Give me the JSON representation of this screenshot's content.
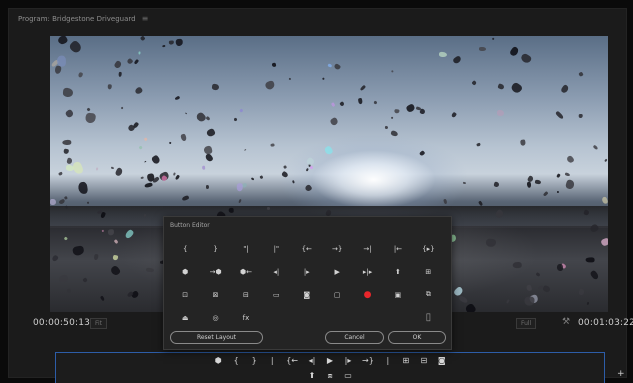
{
  "window": {
    "title": "Program: Bridgestone Driveguard",
    "menu_icon": "menu-lines-icon"
  },
  "timecodes": {
    "current": "00:00:50:13",
    "duration": "00:01:03:22"
  },
  "monitor": {
    "zoom": "Fit",
    "resolution": "Full"
  },
  "transport": {
    "row1": [
      "⬢",
      "{",
      "}",
      "|",
      "{←",
      "◂|",
      "▶",
      "|▸",
      "→}",
      "|",
      "⊞",
      "⊟",
      "◙"
    ],
    "row2": [
      "⬆",
      "⧈",
      "▭"
    ]
  },
  "dialog": {
    "title": "Button Editor",
    "buttons": [
      {
        "glyph": "{",
        "name": "mark-in-icon"
      },
      {
        "glyph": "}",
        "name": "mark-out-icon"
      },
      {
        "glyph": "\"|",
        "name": "clear-in-icon"
      },
      {
        "glyph": "|\"",
        "name": "clear-out-icon"
      },
      {
        "glyph": "{←",
        "name": "go-to-in-icon"
      },
      {
        "glyph": "→}",
        "name": "go-to-out-icon"
      },
      {
        "glyph": "→|",
        "name": "next-edit-icon"
      },
      {
        "glyph": "|←",
        "name": "previous-edit-icon"
      },
      {
        "glyph": "{▸}",
        "name": "play-in-to-out-icon"
      },
      {
        "glyph": "⬢",
        "name": "add-marker-icon"
      },
      {
        "glyph": "→⬢",
        "name": "next-marker-icon"
      },
      {
        "glyph": "⬢←",
        "name": "previous-marker-icon"
      },
      {
        "glyph": "◂|",
        "name": "step-back-icon"
      },
      {
        "glyph": "|▸",
        "name": "step-forward-icon"
      },
      {
        "glyph": "▶",
        "name": "play-icon"
      },
      {
        "glyph": "▸|▸",
        "name": "play-around-icon"
      },
      {
        "glyph": "⬆",
        "name": "export-icon"
      },
      {
        "glyph": "⊞",
        "name": "multi-camera-icon"
      },
      {
        "glyph": "⊡",
        "name": "lift-icon"
      },
      {
        "glyph": "⊠",
        "name": "extract-icon"
      },
      {
        "glyph": "⊟",
        "name": "insert-icon"
      },
      {
        "glyph": "▭",
        "name": "safe-margins-icon"
      },
      {
        "glyph": "◙",
        "name": "export-frame-icon"
      },
      {
        "glyph": "▢",
        "name": "comment-icon"
      },
      {
        "glyph": "●",
        "name": "record-icon",
        "rec": true
      },
      {
        "glyph": "▣",
        "name": "compare-view-icon"
      },
      {
        "glyph": "⧉",
        "name": "overlay-icon"
      },
      {
        "glyph": "⏏",
        "name": "loop-icon"
      },
      {
        "glyph": "◎",
        "name": "vr-video-icon"
      },
      {
        "glyph": "fx",
        "name": "fx-icon"
      },
      {
        "glyph": "",
        "name": "empty-slot"
      },
      {
        "glyph": "",
        "name": "empty-slot"
      },
      {
        "glyph": "",
        "name": "empty-slot"
      },
      {
        "glyph": "",
        "name": "empty-slot"
      },
      {
        "glyph": "",
        "name": "empty-slot"
      },
      {
        "glyph": "▯",
        "name": "spacer-icon",
        "outline": true
      }
    ],
    "reset_label": "Reset Layout",
    "cancel_label": "Cancel",
    "ok_label": "OK"
  }
}
